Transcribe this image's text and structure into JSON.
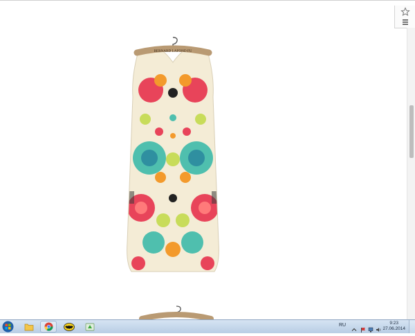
{
  "browser": {
    "toolbar": {
      "bookmark_star_icon": "star-icon",
      "menu_icon": "hamburger-menu-icon"
    }
  },
  "page": {
    "product_image": {
      "label_text": "BERNARD LAFOND FU",
      "colors": {
        "base": "#f4ecd6",
        "rose": "#e8445a",
        "teal": "#4fbfae",
        "orange": "#f39a2c",
        "lime": "#c8dc5a"
      }
    }
  },
  "taskbar": {
    "items": [
      {
        "name": "windows-explorer",
        "icon": "folder-icon"
      },
      {
        "name": "google-chrome",
        "icon": "chrome-icon",
        "active": true
      },
      {
        "name": "batman-app",
        "icon": "bat-logo-icon"
      },
      {
        "name": "green-app",
        "icon": "green-arrow-icon"
      }
    ],
    "tray": {
      "language": "RU",
      "time": "9:23",
      "date": "27.06.2014"
    }
  }
}
